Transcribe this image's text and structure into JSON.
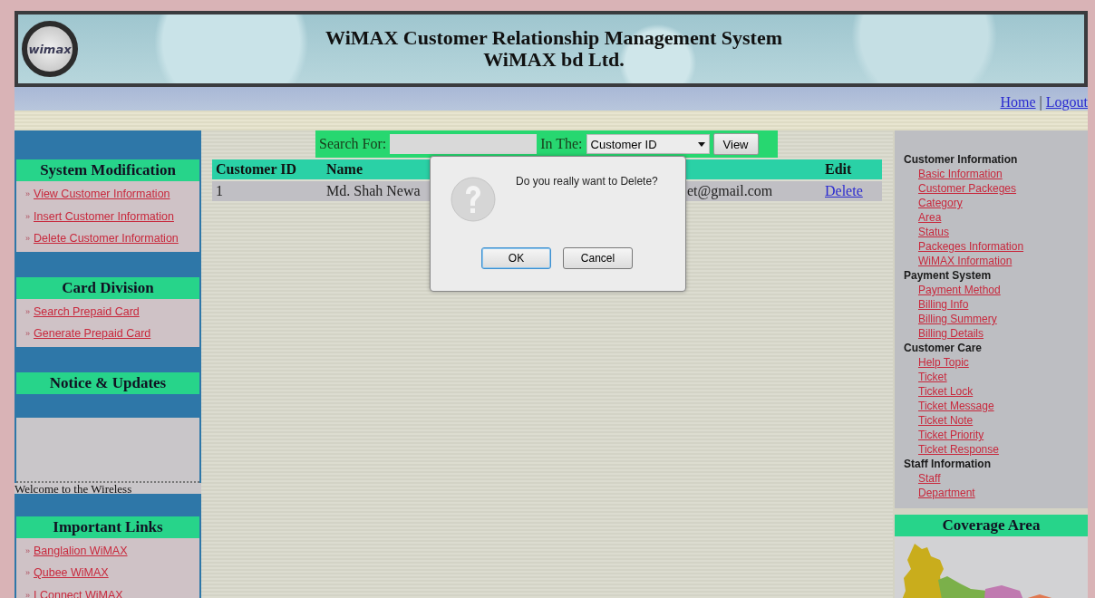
{
  "header": {
    "logo": "wimax",
    "title": "WiMAX Customer Relationship Management System",
    "subtitle": "WiMAX bd Ltd."
  },
  "top_links": {
    "items": [
      "Home",
      "Logout"
    ],
    "separator": "|"
  },
  "left_sections": [
    {
      "kind": "links",
      "heading": "System Modification",
      "links": [
        "View Customer Information",
        "Insert Customer Information",
        "Delete Customer Information"
      ]
    },
    {
      "kind": "links",
      "heading": "Card Division",
      "links": [
        "Search Prepaid Card",
        "Generate Prepaid Card"
      ]
    },
    {
      "kind": "notice",
      "heading": "Notice & Updates",
      "text": "Welcome to the Wireless"
    },
    {
      "kind": "links",
      "heading": "Important Links",
      "links": [
        "Banglalion WiMAX",
        "Qubee WiMAX",
        "I Connect WiMAX"
      ]
    }
  ],
  "link_marker": "»",
  "search": {
    "label": "Search For:",
    "in_label": "In The:",
    "select": "Customer ID",
    "button": "View"
  },
  "table": {
    "columns": [
      "Customer ID",
      "Name",
      "",
      "Edit"
    ],
    "rows": [
      {
        "cells": [
          "1",
          "Md. Shah Newa",
          "et@gmail.com",
          "Delete"
        ]
      }
    ]
  },
  "dialog": {
    "message": "Do you really want to Delete?",
    "buttons": [
      {
        "label": "OK",
        "default": true
      },
      {
        "label": "Cancel",
        "default": false
      }
    ]
  },
  "right_menu": [
    {
      "title": "Customer Information",
      "links": [
        "Basic Information",
        "Customer Packeges",
        "Category",
        "Area",
        "Status",
        "Packeges Information",
        "WiMAX Information"
      ]
    },
    {
      "title": "Payment System",
      "links": [
        "Payment Method",
        "Billing Info",
        "Billing Summery",
        "Billing Details"
      ]
    },
    {
      "title": "Customer Care",
      "links": [
        "Help Topic",
        "Ticket",
        "Ticket Lock",
        "Ticket Message",
        "Ticket Note",
        "Ticket Priority",
        "Ticket Response"
      ]
    },
    {
      "title": "Staff Information",
      "links": [
        "Staff",
        "Department"
      ]
    }
  ],
  "coverage": {
    "heading": "Coverage Area"
  }
}
